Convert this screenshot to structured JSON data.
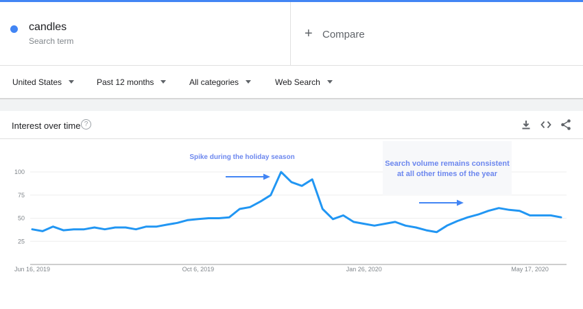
{
  "search_term": {
    "name": "candles",
    "subtitle": "Search term",
    "color": "#4285f4"
  },
  "compare": {
    "icon": "plus-icon",
    "label": "Compare"
  },
  "filters": [
    {
      "label": "United States"
    },
    {
      "label": "Past 12 months"
    },
    {
      "label": "All categories"
    },
    {
      "label": "Web Search"
    }
  ],
  "card": {
    "title": "Interest over time",
    "help_icon": "?",
    "tools": [
      "download-icon",
      "embed-code-icon",
      "share-icon"
    ]
  },
  "chart_data": {
    "type": "line",
    "title": "",
    "xlabel": "",
    "ylabel": "",
    "ylim": [
      0,
      100
    ],
    "yticks": [
      25,
      50,
      75,
      100
    ],
    "grid": true,
    "line_color": "#2196f3",
    "x_tick_labels": [
      "Jun 16, 2019",
      "Oct 6, 2019",
      "Jan 26, 2020",
      "May 17, 2020"
    ],
    "x_tick_indices": [
      0,
      16,
      32,
      48
    ],
    "series": [
      {
        "name": "",
        "values": [
          38,
          36,
          41,
          37,
          38,
          38,
          40,
          38,
          40,
          40,
          38,
          41,
          41,
          43,
          45,
          48,
          49,
          50,
          50,
          51,
          60,
          62,
          68,
          75,
          100,
          89,
          85,
          92,
          60,
          49,
          53,
          46,
          44,
          42,
          44,
          46,
          42,
          40,
          37,
          35,
          42,
          47,
          51,
          54,
          58,
          61,
          59,
          58,
          53,
          53,
          53,
          51
        ]
      }
    ],
    "annotations": [
      {
        "text": "Spike during the holiday season"
      },
      {
        "lines": [
          "Search volume remains consistent",
          "at all other times of the year"
        ]
      }
    ]
  }
}
